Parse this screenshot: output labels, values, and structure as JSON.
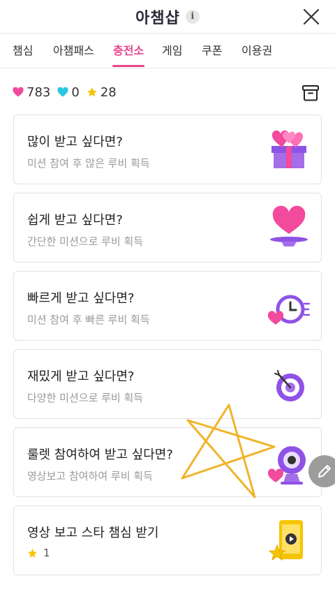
{
  "header": {
    "title": "아챔샵",
    "info_icon": "i"
  },
  "tabs": [
    {
      "label": "챔심"
    },
    {
      "label": "아챔패스"
    },
    {
      "label": "충전소",
      "active": true
    },
    {
      "label": "게임"
    },
    {
      "label": "쿠폰"
    },
    {
      "label": "이용권"
    }
  ],
  "stats": {
    "hearts_pink": "783",
    "hearts_blue": "0",
    "stars": "28"
  },
  "cards": [
    {
      "title": "많이 받고 싶다면?",
      "subtitle": "미션 참여 후 많은 루비 획득",
      "icon": "gift-hearts-icon"
    },
    {
      "title": "쉽게 받고 싶다면?",
      "subtitle": "간단한 미션으로 루비 획득",
      "icon": "heart-plate-icon"
    },
    {
      "title": "빠르게 받고 싶다면?",
      "subtitle": "미션 참여 후 빠른 루비 획득",
      "icon": "fast-clock-icon"
    },
    {
      "title": "재밌게 받고 싶다면?",
      "subtitle": "다양한 미션으로 루비 획득",
      "icon": "target-icon"
    },
    {
      "title": "룰렛 참여하여 받고 싶다면?",
      "subtitle": "영상보고 참여하여 루비 획득",
      "icon": "webcam-roulette-icon"
    },
    {
      "title": "영상 보고 스타 챔심 받기",
      "count": "1",
      "icon": "video-star-icon"
    }
  ],
  "colors": {
    "accent": "#e8458b",
    "purple": "#8f52e6",
    "heart_pink": "#f24a9c",
    "heart_blue": "#2ac7e0",
    "star_yellow": "#f6c400",
    "annotation": "#f0b429"
  }
}
